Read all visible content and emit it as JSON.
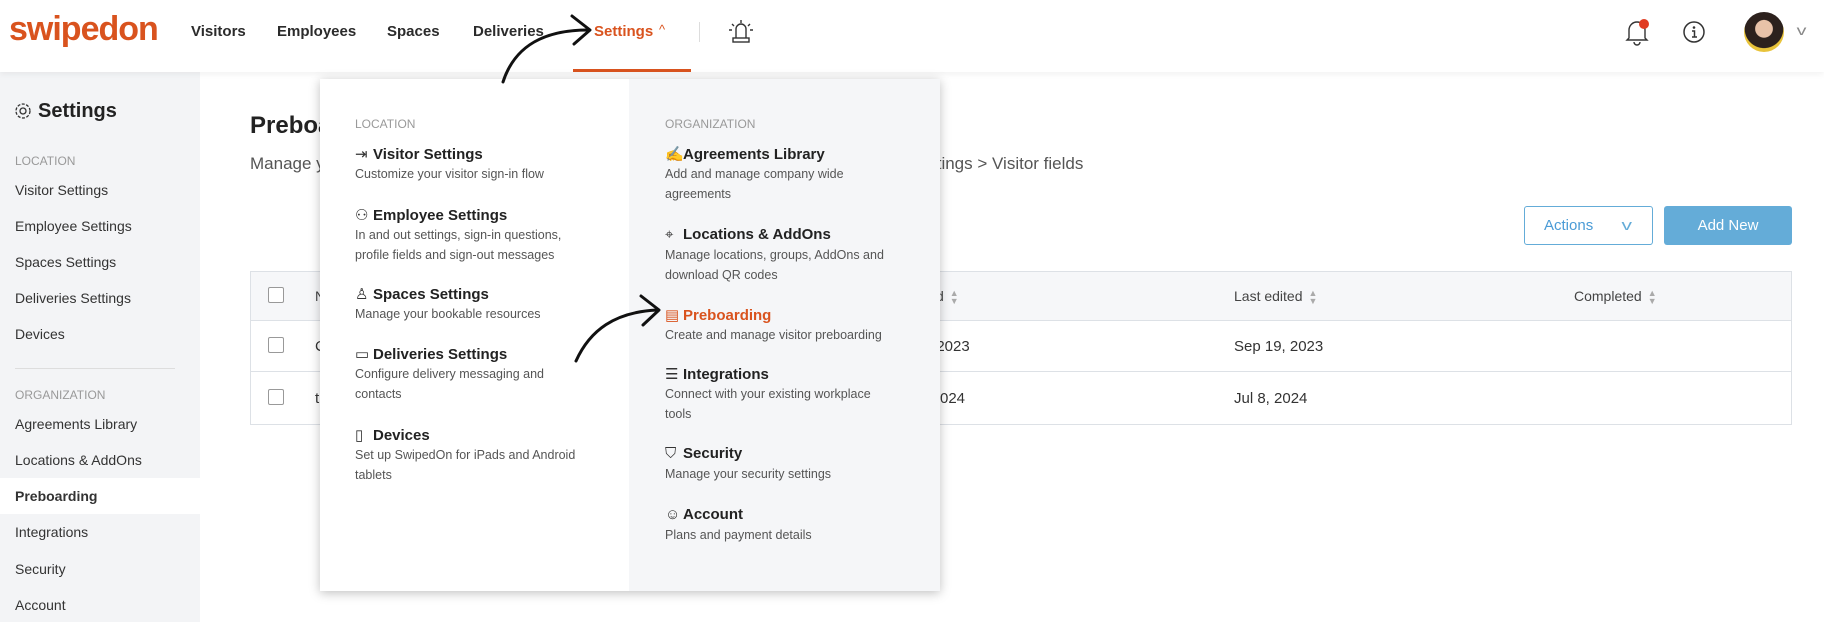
{
  "brand": {
    "logo": "swipedon",
    "accent": "#d9531e"
  },
  "nav": {
    "items": [
      "Visitors",
      "Employees",
      "Spaces",
      "Deliveries",
      "Settings"
    ],
    "active": "Settings",
    "alarm_icon": "alarm-light-icon",
    "bell_icon": "bell-icon",
    "info_icon": "info-icon",
    "avatar": "user-avatar"
  },
  "sidebar": {
    "title": "Settings",
    "location_heading": "LOCATION",
    "location_items": [
      "Visitor Settings",
      "Employee Settings",
      "Spaces Settings",
      "Deliveries Settings",
      "Devices"
    ],
    "org_heading": "ORGANIZATION",
    "org_items": [
      "Agreements Library",
      "Locations & AddOns",
      "Preboarding",
      "Integrations",
      "Security",
      "Account"
    ],
    "active": "Preboarding"
  },
  "main": {
    "title": "Preboa",
    "subtitle_left": "Manage y",
    "subtitle_right": "ttings > Visitor fields",
    "actions_label": "Actions",
    "add_new_label": "Add New",
    "table": {
      "headers": [
        "N",
        "d",
        "Last edited",
        "Completed"
      ],
      "rows": [
        {
          "name": "C",
          "created": ", 2023",
          "last_edited": "Sep 19, 2023",
          "completed": ""
        },
        {
          "name": "t",
          "created": "024",
          "last_edited": "Jul 8, 2024",
          "completed": ""
        }
      ]
    }
  },
  "dropdown": {
    "location": {
      "heading": "LOCATION",
      "items": [
        {
          "title": "Visitor Settings",
          "desc": [
            "Customize your visitor sign-in flow"
          ]
        },
        {
          "title": "Employee Settings",
          "desc": [
            "In and out settings, sign-in questions,",
            "profile fields and sign-out messages"
          ]
        },
        {
          "title": "Spaces Settings",
          "desc": [
            "Manage your bookable resources"
          ]
        },
        {
          "title": "Deliveries Settings",
          "desc": [
            "Configure delivery messaging and",
            "contacts"
          ]
        },
        {
          "title": "Devices",
          "desc": [
            "Set up SwipedOn for iPads and Android",
            "tablets"
          ]
        }
      ]
    },
    "organization": {
      "heading": "ORGANIZATION",
      "items": [
        {
          "title": "Agreements Library",
          "desc": [
            "Add and manage company wide",
            "agreements"
          ]
        },
        {
          "title": "Locations & AddOns",
          "desc": [
            "Manage locations, groups, AddOns and",
            "download QR codes"
          ]
        },
        {
          "title": "Preboarding",
          "desc": [
            "Create and manage visitor preboarding"
          ]
        },
        {
          "title": "Integrations",
          "desc": [
            "Connect with your existing workplace",
            "tools"
          ]
        },
        {
          "title": "Security",
          "desc": [
            "Manage your security settings"
          ]
        },
        {
          "title": "Account",
          "desc": [
            "Plans and payment details"
          ]
        }
      ]
    }
  }
}
